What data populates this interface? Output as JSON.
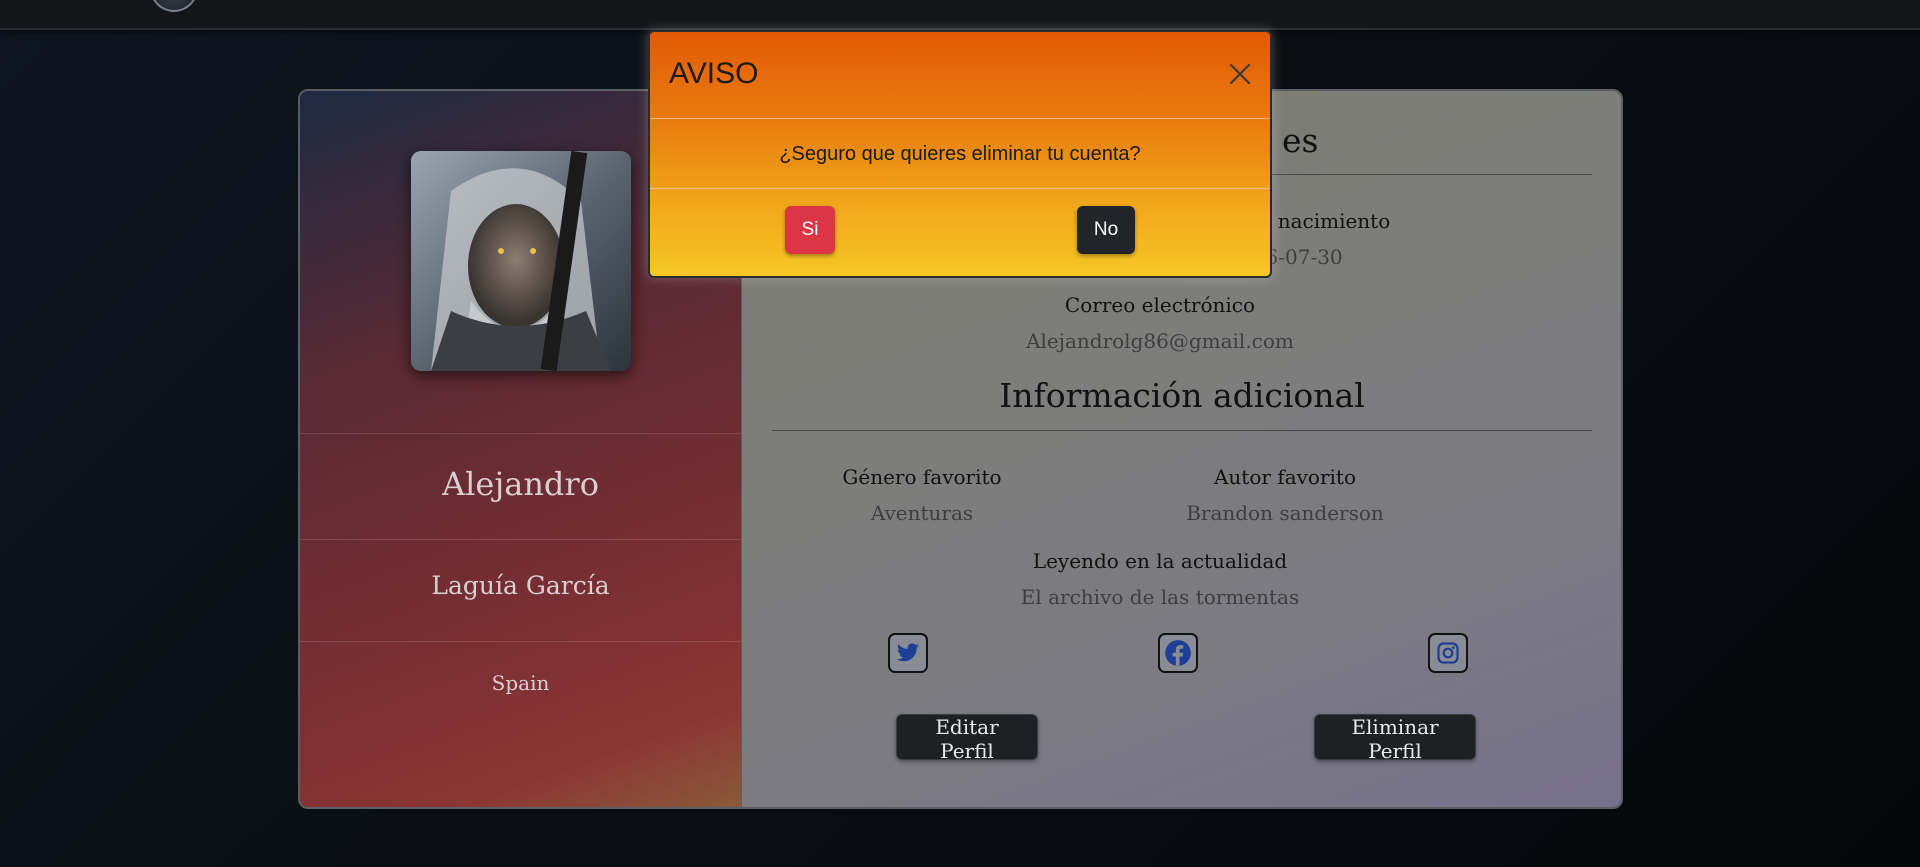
{
  "modal": {
    "title": "AVISO",
    "message": "¿Seguro que quieres eliminar tu cuenta?",
    "confirm_label": "Si",
    "cancel_label": "No",
    "close_icon": "close-icon"
  },
  "profile": {
    "first_name": "Alejandro",
    "last_name": "Laguía García",
    "country": "Spain",
    "photo": "profile-photo"
  },
  "personal": {
    "section_title_partial": "es",
    "birth_label": "Fecha de nacimiento",
    "birth_value": "1986-07-30",
    "email_label": "Correo electrónico",
    "email_value": "Alejandrolg86@gmail.com"
  },
  "additional": {
    "section_title": "Información adicional",
    "genre_label": "Género favorito",
    "genre_value": "Aventuras",
    "author_label": "Autor favorito",
    "author_value": "Brandon sanderson",
    "reading_label": "Leyendo en la actualidad",
    "reading_value": "El archivo de las tormentas"
  },
  "social": [
    {
      "icon": "twitter-icon"
    },
    {
      "icon": "facebook-icon"
    },
    {
      "icon": "instagram-icon"
    }
  ],
  "actions": {
    "edit_label": "Editar Perfil",
    "delete_label": "Eliminar Perfil"
  },
  "colors": {
    "danger": "#dc3545",
    "dark": "#212529",
    "modal_top": "#e35a07",
    "modal_bottom": "#f6c725",
    "social_icon": "#1d3f95"
  }
}
